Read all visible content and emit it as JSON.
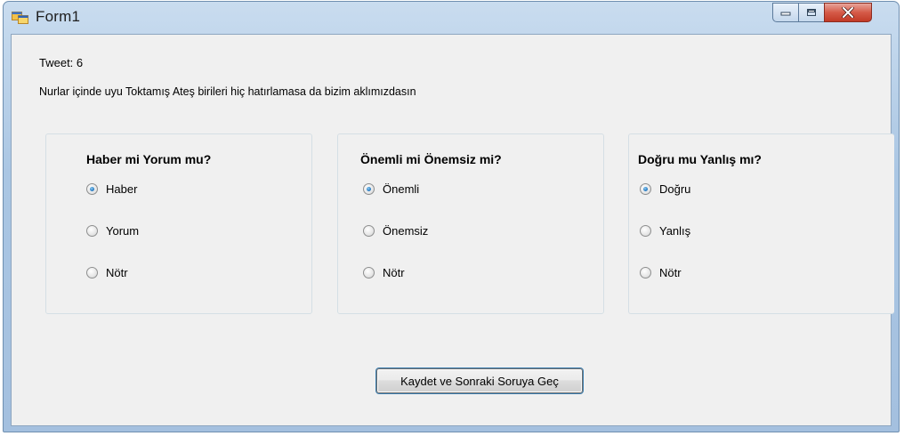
{
  "window": {
    "title": "Form1"
  },
  "tweet_counter": "Tweet: 6",
  "tweet_text": "Nurlar içinde uyu Toktamış Ateş birileri hiç hatırlamasa da bizim aklımızdasın",
  "groups": [
    {
      "title": "Haber mi Yorum mu?",
      "options": [
        {
          "label": "Haber",
          "checked": true
        },
        {
          "label": "Yorum",
          "checked": false
        },
        {
          "label": "Nötr",
          "checked": false
        }
      ]
    },
    {
      "title": "Önemli mi Önemsiz mi?",
      "options": [
        {
          "label": "Önemli",
          "checked": true
        },
        {
          "label": "Önemsiz",
          "checked": false
        },
        {
          "label": "Nötr",
          "checked": false
        }
      ]
    },
    {
      "title": "Doğru mu Yanlış mı?",
      "options": [
        {
          "label": "Doğru",
          "checked": true
        },
        {
          "label": "Yanlış",
          "checked": false
        },
        {
          "label": "Nötr",
          "checked": false
        }
      ]
    }
  ],
  "submit_label": "Kaydet ve Sonraki Soruya Geç",
  "colors": {
    "close_button": "#c9452f",
    "titlebar": "#aac6e3",
    "client_bg": "#f0f0f0"
  }
}
